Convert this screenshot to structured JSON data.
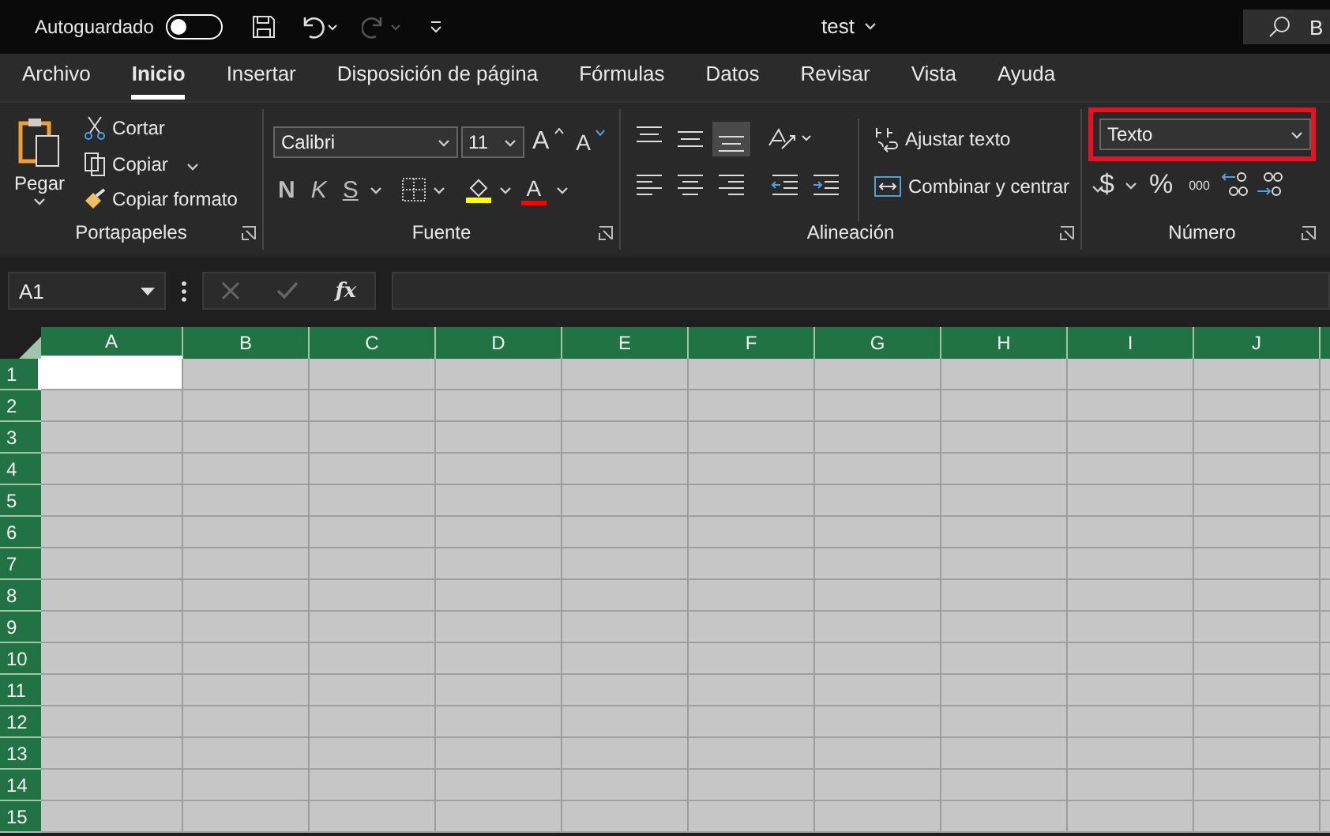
{
  "title_bar": {
    "autosave_label": "Autoguardado",
    "autosave_on": false,
    "doc_title": "test",
    "search_text": "B"
  },
  "menu_tabs": [
    {
      "label": "Archivo",
      "selected": false
    },
    {
      "label": "Inicio",
      "selected": true
    },
    {
      "label": "Insertar",
      "selected": false
    },
    {
      "label": "Disposición de página",
      "selected": false
    },
    {
      "label": "Fórmulas",
      "selected": false
    },
    {
      "label": "Datos",
      "selected": false
    },
    {
      "label": "Revisar",
      "selected": false
    },
    {
      "label": "Vista",
      "selected": false
    },
    {
      "label": "Ayuda",
      "selected": false
    }
  ],
  "ribbon": {
    "clipboard": {
      "paste": "Pegar",
      "cut": "Cortar",
      "copy": "Copiar",
      "format_painter": "Copiar formato",
      "label": "Portapapeles"
    },
    "font": {
      "font_name": "Calibri",
      "font_size": "11",
      "grow": "A",
      "shrink": "A",
      "bold": "N",
      "italic": "K",
      "underline": "S",
      "font_color": "A",
      "label": "Fuente"
    },
    "alignment": {
      "vertical": [
        {
          "selected": false
        },
        {
          "selected": false
        },
        {
          "selected": true
        }
      ],
      "wrap_text": "Ajustar texto",
      "merge": "Combinar y centrar",
      "label": "Alineación"
    },
    "number": {
      "format": "Texto",
      "highlighted": true,
      "currency": "$",
      "percent": "%",
      "thousands": "000",
      "label": "Número"
    }
  },
  "formula_bar": {
    "name_box": "A1",
    "fx": "fx"
  },
  "grid": {
    "columns": [
      {
        "label": "A",
        "selected": true
      },
      {
        "label": "B",
        "selected": false
      },
      {
        "label": "C",
        "selected": false
      },
      {
        "label": "D",
        "selected": false
      },
      {
        "label": "E",
        "selected": false
      },
      {
        "label": "F",
        "selected": false
      },
      {
        "label": "G",
        "selected": false
      },
      {
        "label": "H",
        "selected": false
      },
      {
        "label": "I",
        "selected": false
      },
      {
        "label": "J",
        "selected": false
      }
    ],
    "rows": [
      {
        "label": "1",
        "selected": true
      },
      {
        "label": "2",
        "selected": false
      },
      {
        "label": "3",
        "selected": false
      },
      {
        "label": "4",
        "selected": false
      },
      {
        "label": "5",
        "selected": false
      },
      {
        "label": "6",
        "selected": false
      },
      {
        "label": "7",
        "selected": false
      },
      {
        "label": "8",
        "selected": false
      },
      {
        "label": "9",
        "selected": false
      },
      {
        "label": "10",
        "selected": false
      },
      {
        "label": "11",
        "selected": false
      },
      {
        "label": "12",
        "selected": false
      },
      {
        "label": "13",
        "selected": false
      },
      {
        "label": "14",
        "selected": false
      },
      {
        "label": "15",
        "selected": false
      }
    ]
  }
}
